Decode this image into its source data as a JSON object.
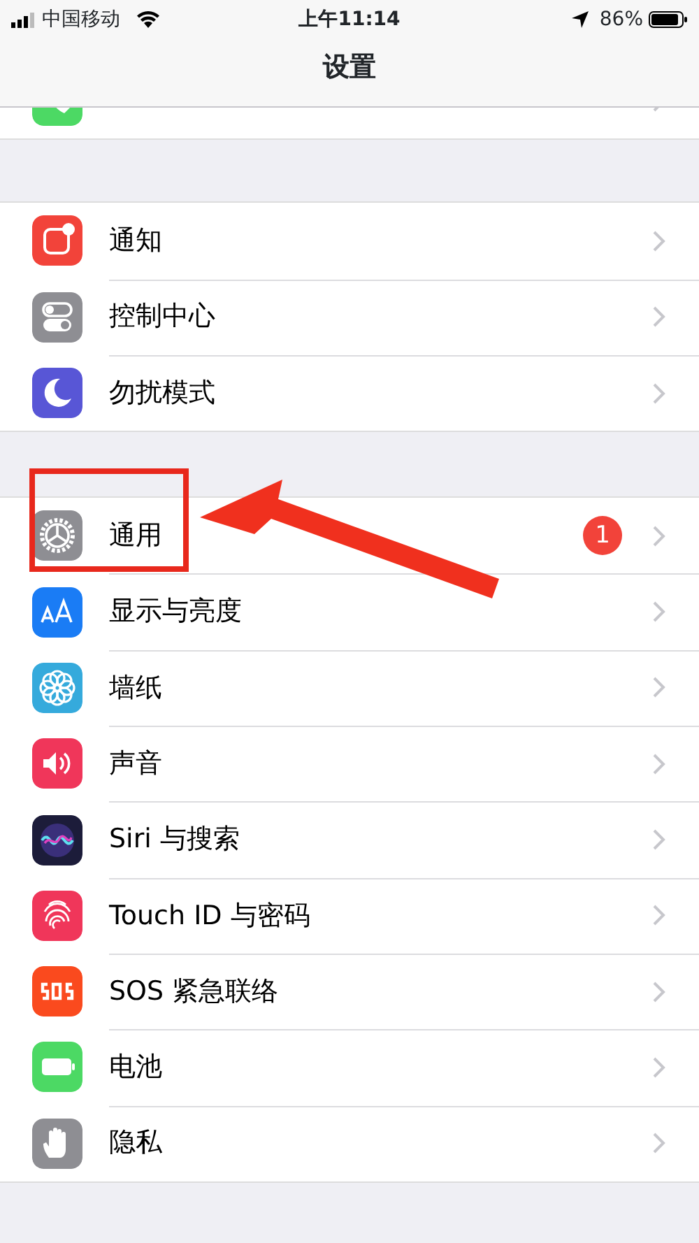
{
  "status_bar": {
    "carrier": "中国移动",
    "time": "上午11:14",
    "battery": "86%"
  },
  "nav_bar": {
    "title": "设置"
  },
  "groups": [
    {
      "rows": [
        {
          "color": "#4cd964"
        }
      ]
    },
    {
      "rows": [
        {
          "label": "通知",
          "color": "#f2433a"
        },
        {
          "label": "控制中心",
          "color": "#8e8e93"
        },
        {
          "label": "勿扰模式",
          "color": "#5856d6"
        }
      ]
    },
    {
      "rows": [
        {
          "label": "通用",
          "color": "#8e8e93",
          "badge": "1"
        },
        {
          "label": "显示与亮度",
          "color": "#1a7cf5"
        },
        {
          "label": "墙纸",
          "color": "#35aadc"
        },
        {
          "label": "声音",
          "color": "#f0365a"
        },
        {
          "label": "Siri 与搜索",
          "color": "#1c1c3a"
        },
        {
          "label": "Touch ID 与密码",
          "color": "#f0365a"
        },
        {
          "label": "SOS 紧急联络",
          "color": "#fa4a1e"
        },
        {
          "label": "电池",
          "color": "#4cd964"
        },
        {
          "label": "隐私",
          "color": "#8e8e93"
        }
      ]
    }
  ]
}
